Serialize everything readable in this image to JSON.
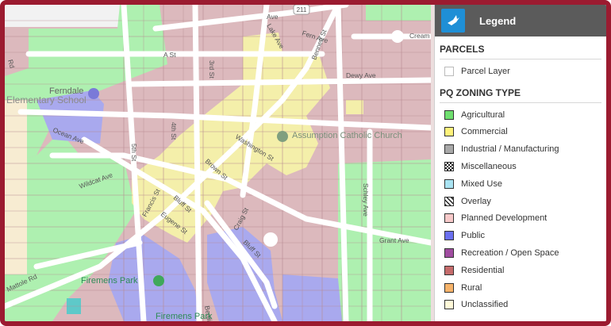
{
  "map": {
    "streets": [
      "Ave",
      "Fern Ave",
      "A St",
      "3rd St",
      "Lake Ave",
      "Bennett St",
      "Dewy Ave",
      "Ferndale",
      "Ocean Ave",
      "4th St",
      "5th St",
      "Washington St",
      "Brown St",
      "Francis St",
      "Bluff St",
      "Wildcat Ave",
      "Eugene St",
      "Craig St",
      "Grant Ave",
      "Bluff St",
      "Mattole Rd",
      "Schley Ave",
      "Cream",
      "Rd",
      "Berding St"
    ],
    "places": [
      "Elementary School",
      "Assumption Catholic Church",
      "Firemens Park",
      "Firemens Park"
    ],
    "highway_shield": "211"
  },
  "legend": {
    "title": "Legend",
    "parcels_heading": "PARCELS",
    "parcel_layer": "Parcel Layer",
    "zoning_heading": "PQ ZONING TYPE",
    "items": [
      {
        "label": "Agricultural",
        "color": "#6fdf6f"
      },
      {
        "label": "Commercial",
        "color": "#fff27a"
      },
      {
        "label": "Industrial / Manufacturing",
        "color": "#a8a8a8"
      },
      {
        "label": "Miscellaneous",
        "color": "#ffffff"
      },
      {
        "label": "Mixed Use",
        "color": "#a9e3f2"
      },
      {
        "label": "Overlay",
        "color": "#ffffff"
      },
      {
        "label": "Planned Development",
        "color": "#f7c9c9"
      },
      {
        "label": "Public",
        "color": "#6a6ff0"
      },
      {
        "label": "Recreation / Open Space",
        "color": "#a04ca0"
      },
      {
        "label": "Residential",
        "color": "#c56b6b"
      },
      {
        "label": "Rural",
        "color": "#f6b36a"
      },
      {
        "label": "Unclassified",
        "color": "#fff9d8"
      }
    ]
  },
  "colors": {
    "frame": "#9b1b30",
    "residential_fill": "#dcb9bd",
    "commercial_fill": "#f4efaa",
    "public_fill": "#a9a9ee",
    "agricultural_fill": "#aef0b0"
  }
}
